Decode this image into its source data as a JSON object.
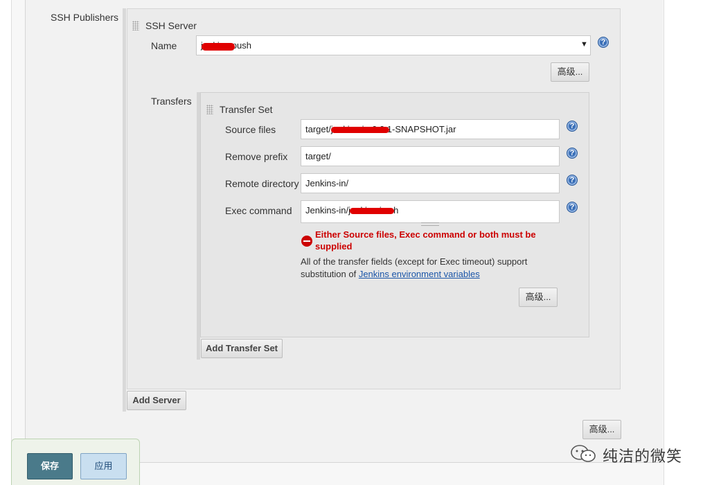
{
  "ssh_publishers": {
    "section_label": "SSH Publishers",
    "server": {
      "title": "SSH Server",
      "name_label": "Name",
      "name_value": "jenkins-push",
      "advanced_button": "高级...",
      "help_glyph": "?"
    },
    "transfers": {
      "label": "Transfers",
      "transfer_set": {
        "title": "Transfer Set",
        "fields": [
          {
            "label": "Source files",
            "value": "target/jenkins-in-0.0.1-SNAPSHOT.jar"
          },
          {
            "label": "Remove prefix",
            "value": "target/"
          },
          {
            "label": "Remote directory",
            "value": "Jenkins-in/"
          },
          {
            "label": "Exec command",
            "value": "Jenkins-in/jenkins-in.sh"
          }
        ],
        "error": "Either Source files, Exec command or both must be supplied",
        "note_prefix": "All of the transfer fields (except for Exec timeout) support substitution of ",
        "note_link": "Jenkins environment variables",
        "advanced_button": "高级..."
      },
      "add_transfer_set_button": "Add Transfer Set"
    },
    "add_server_button": "Add Server",
    "advanced_button": "高级..."
  },
  "footer": {
    "save_button": "保存",
    "apply_button": "应用"
  },
  "watermark": "纯洁的微笑",
  "colors": {
    "error": "#cc0000",
    "help_icon": "#3a6fb7",
    "save_button": "#4a7a8a",
    "apply_button": "#c9dff0",
    "link": "#1a55a8"
  }
}
